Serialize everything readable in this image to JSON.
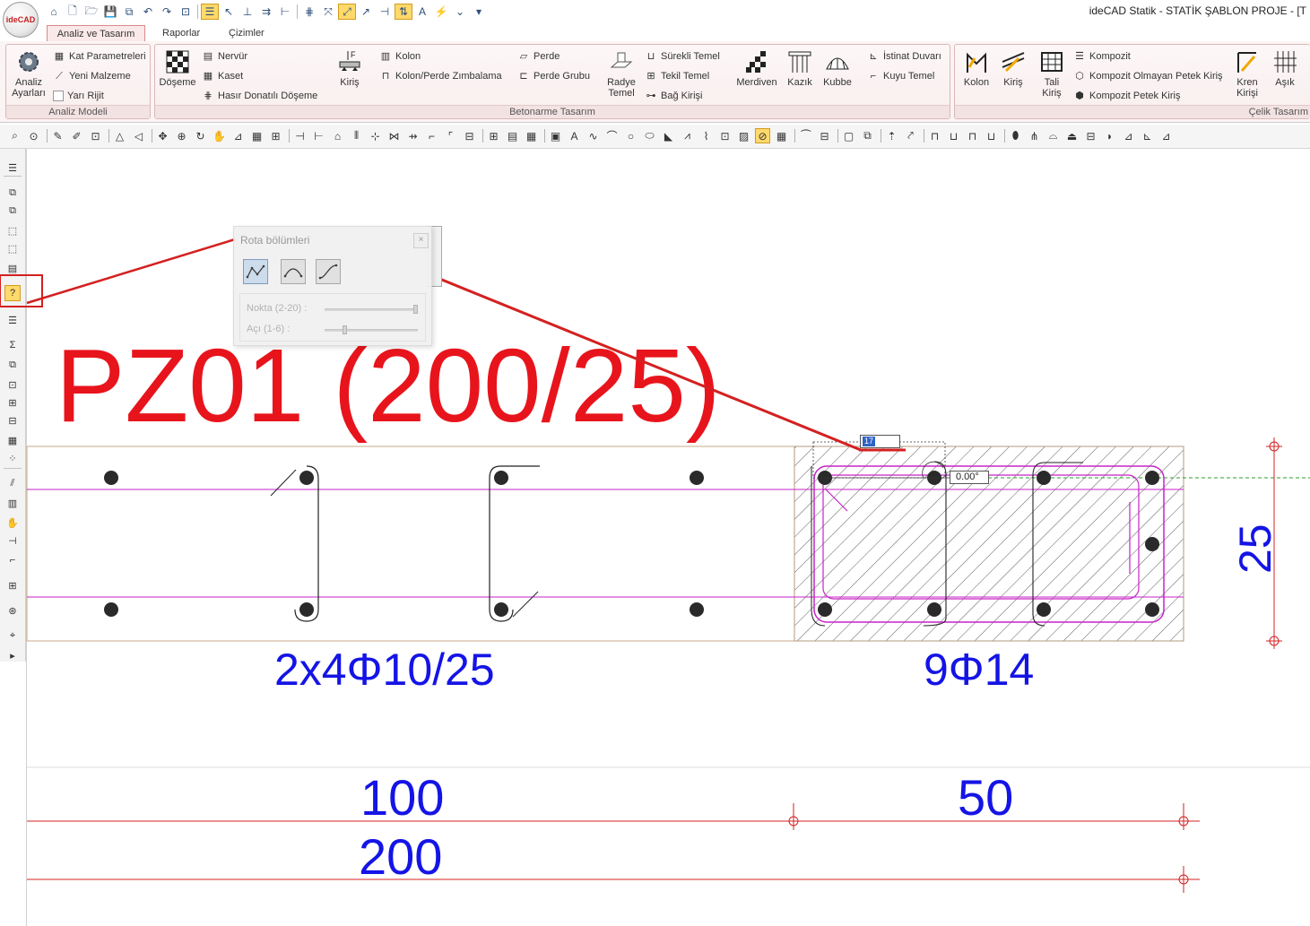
{
  "app": {
    "logo_text": "ideCAD",
    "window_title": "ideCAD Statik - STATİK ŞABLON PROJE - [T"
  },
  "quick_access": {
    "icons": [
      "home-icon",
      "new-file-icon",
      "open-folder-icon",
      "save-icon",
      "save-all-icon",
      "undo-icon",
      "redo-icon",
      "zoom-window-icon",
      "layer-list-icon",
      "select-cursor-icon",
      "align-bottom-icon",
      "align-icon",
      "grid-icon",
      "snap-icon",
      "snap-active-icon",
      "rotation-icon",
      "pin-icon",
      "axis-icon",
      "text-style-icon",
      "lightning-icon",
      "dropdown-arrow-icon"
    ]
  },
  "ribbon": {
    "tabs": [
      "Analiz ve Tasarım",
      "Raporlar",
      "Çizimler"
    ],
    "active_tab": "Analiz ve Tasarım",
    "groups": {
      "analiz_modeli": {
        "label": "Analiz Modeli",
        "analiz_ayarlari": "Analiz Ayarları",
        "kat_parametreleri": "Kat Parametreleri",
        "yeni_malzeme": "Yeni Malzeme",
        "yari_rijit": "Yarı Rijit"
      },
      "betonarme": {
        "label": "Betonarme Tasarım",
        "doseme": "Döşeme",
        "nervur": "Nervür",
        "kaset": "Kaset",
        "hasir": "Hasır Donatılı Döşeme",
        "kiris": "Kiriş",
        "kolon": "Kolon",
        "kolon_perde_zimbalama": "Kolon/Perde Zımbalama",
        "perde": "Perde",
        "perde_grubu": "Perde Grubu",
        "radye_temel": "Radye Temel",
        "surekli_temel": "Sürekli Temel",
        "tekil_temel": "Tekil Temel",
        "bag_kirisi": "Bağ Kirişi",
        "merdiven": "Merdiven",
        "kazik": "Kazık",
        "kubbe": "Kubbe",
        "istinat_duvari": "İstinat Duvarı",
        "kuyu_temel": "Kuyu Temel"
      },
      "celik": {
        "label": "Çelik Tasarım",
        "kolon": "Kolon",
        "kiris": "Kiriş",
        "tali_kiris": "Tali Kiriş",
        "kompozit": "Kompozit",
        "kompozit_olmayan": "Kompozit Olmayan Petek Kiriş",
        "kompozit_petek": "Kompozit Petek Kiriş",
        "kren_kirisi": "Kren Kirişi",
        "asik": "Aşık"
      }
    }
  },
  "dialog": {
    "title": "Rota bölümleri",
    "close_glyph": "×",
    "nokta_label": "Nokta (2-20) :",
    "aci_label": "Açı (1-6) :",
    "nokta_value": 20,
    "aci_value": 2
  },
  "drawing": {
    "title": "PZ01 (200/25)",
    "stirrup_label": "2x4Φ10/25",
    "bar_label": "9Φ14",
    "height_label": "25",
    "dim_100": "100",
    "dim_50": "50",
    "dim_200": "200",
    "angle_value": "0.00°",
    "length_value": "17"
  },
  "colors": {
    "title_red": "#e8141c",
    "dimension_blue": "#1414e6",
    "rebar_magenta": "#c822c8",
    "leader_red": "#d42020",
    "guide_green": "#2aa02a",
    "section_border": "#c8aa8a",
    "highlight_orange": "#ffd96a"
  }
}
